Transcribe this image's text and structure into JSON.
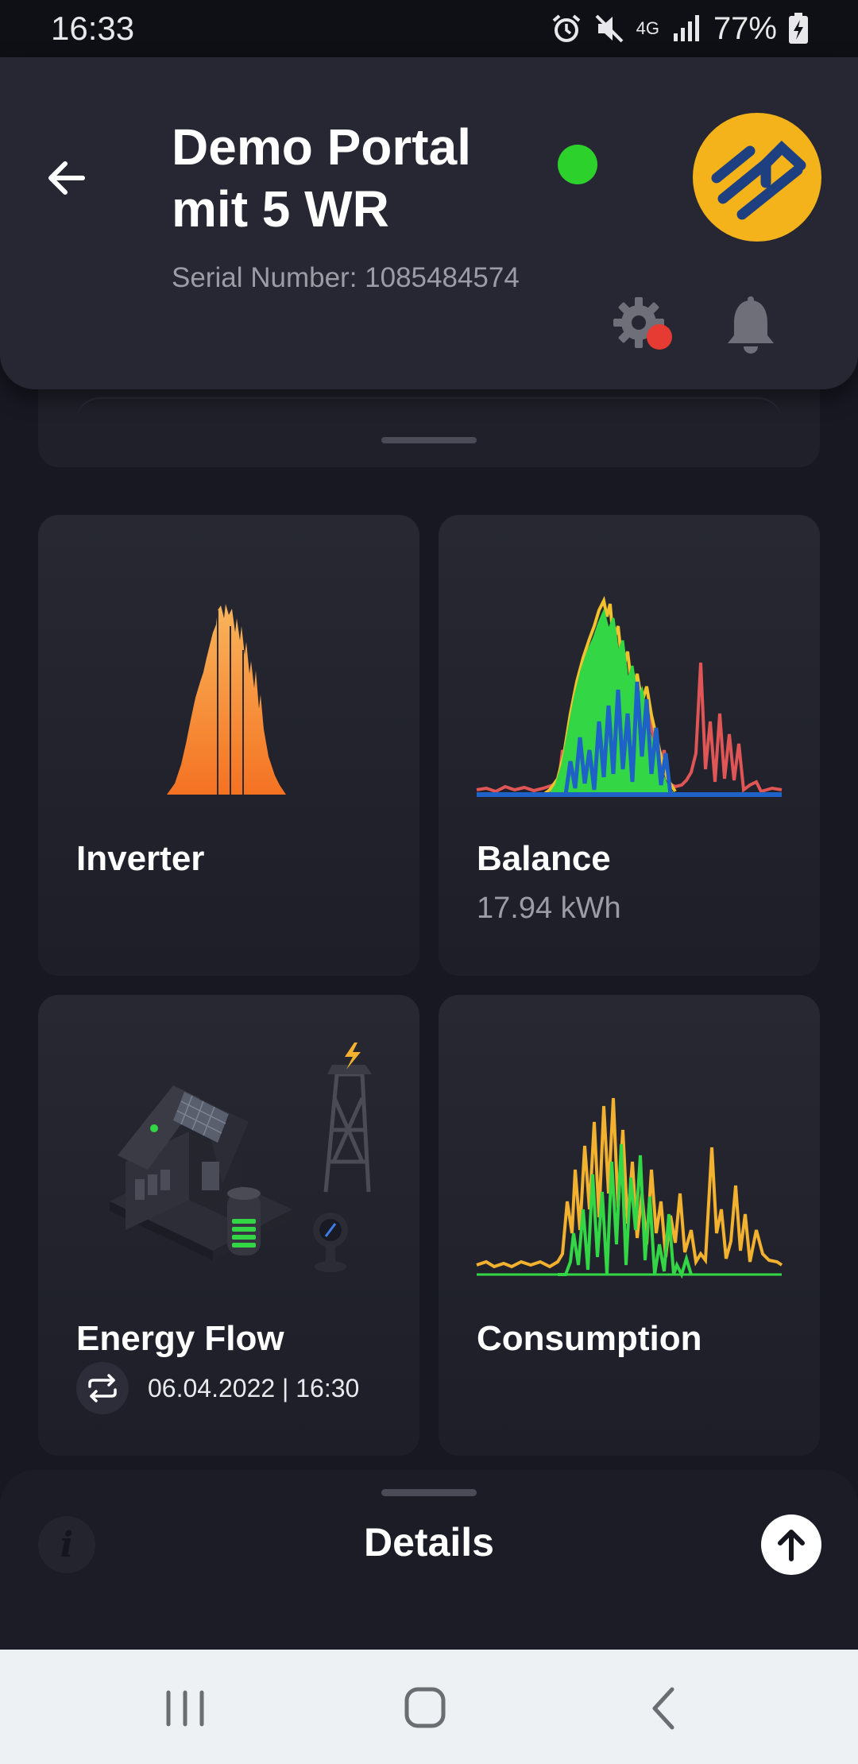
{
  "status_bar": {
    "time": "16:33",
    "network": "4G",
    "battery": "77%",
    "icons": [
      "alarm-icon",
      "mute-icon",
      "signal-icon",
      "battery-charging-icon"
    ]
  },
  "header": {
    "title_line1": "Demo Portal",
    "title_line2": "mit 5 WR",
    "serial": "Serial Number: 1085484574",
    "online_color": "#2cd12c",
    "logo_color": "#f4b21b",
    "settings_badge_color": "#e63b32"
  },
  "tiles": {
    "inverter": {
      "title": "Inverter",
      "chart_color": "#f7862a"
    },
    "balance": {
      "title": "Balance",
      "value": "17.94 kWh",
      "series_colors": [
        "#e05555",
        "#f2c12e",
        "#33d645",
        "#1f62c7"
      ]
    },
    "energy_flow": {
      "title": "Energy Flow",
      "datetime": "06.04.2022 | 16:30"
    },
    "consumption": {
      "title": "Consumption",
      "series_colors": [
        "#f2b12e",
        "#33d645"
      ]
    }
  },
  "details": {
    "title": "Details"
  },
  "colors": {
    "background": "#171821",
    "card": "#262733",
    "accent": "#f4b21b"
  }
}
